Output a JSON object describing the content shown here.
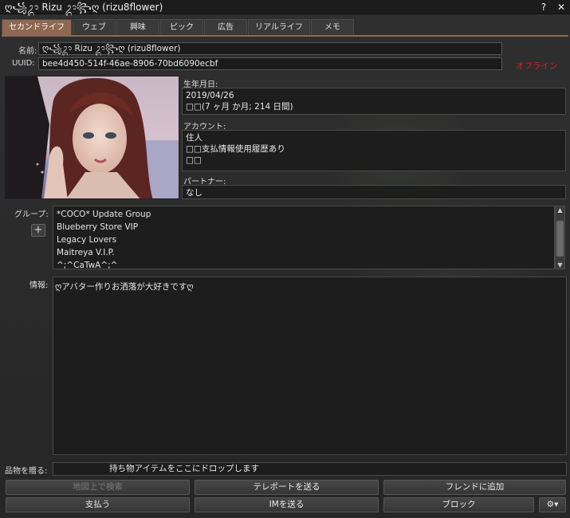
{
  "window": {
    "title": "ღ꧁ᬊ Rizu ᬊ꧂ღ (rizu8flower)",
    "help_label": "?",
    "close_label": "✕"
  },
  "tabs": [
    {
      "label": "セカンドライフ",
      "active": true
    },
    {
      "label": "ウェブ"
    },
    {
      "label": "興味"
    },
    {
      "label": "ピック"
    },
    {
      "label": "広告"
    },
    {
      "label": "リアルライフ"
    },
    {
      "label": "メモ"
    }
  ],
  "profile": {
    "name_label": "名前:",
    "name_value": "ღ꧁ᬊ Rizu ᬊ꧂ღ (rizu8flower)",
    "uuid_label": "UUID:",
    "uuid_value": "bee4d450-514f-46ae-8906-70bd6090ecbf",
    "status": "オフライン",
    "birthdate_label": "生年月日:",
    "birthdate_value": "2019/04/26",
    "age_value": "□□(7 ヶ月 か月; 214 日間)",
    "account_label": "アカウント:",
    "account_lines": [
      "住人",
      "□□支払情報使用履歴あり",
      "□□"
    ],
    "partner_label": "パートナー:",
    "partner_value": "なし"
  },
  "groups": {
    "label": "グループ:",
    "add_label": "+",
    "items": [
      "*COCO* Update Group",
      "Blueberry Store VIP",
      "Legacy Lovers",
      "Maitreya V.I.P.",
      "^;^CaTwA^;^"
    ]
  },
  "about": {
    "label": "情報:",
    "text": "ღアバター作りお洒落が大好きですღ"
  },
  "give": {
    "label": "品物を贈る:",
    "dropzone_text": "持ち物アイテムをここにドロップします"
  },
  "buttons": {
    "map": "地図上で検索",
    "teleport": "テレポートを送る",
    "add_friend": "フレンドに追加",
    "pay": "支払う",
    "im": "IMを送る",
    "block": "ブロック",
    "gear": "⚙▾"
  },
  "colors": {
    "accent_tab": "#8e6852",
    "offline": "#e02020"
  }
}
